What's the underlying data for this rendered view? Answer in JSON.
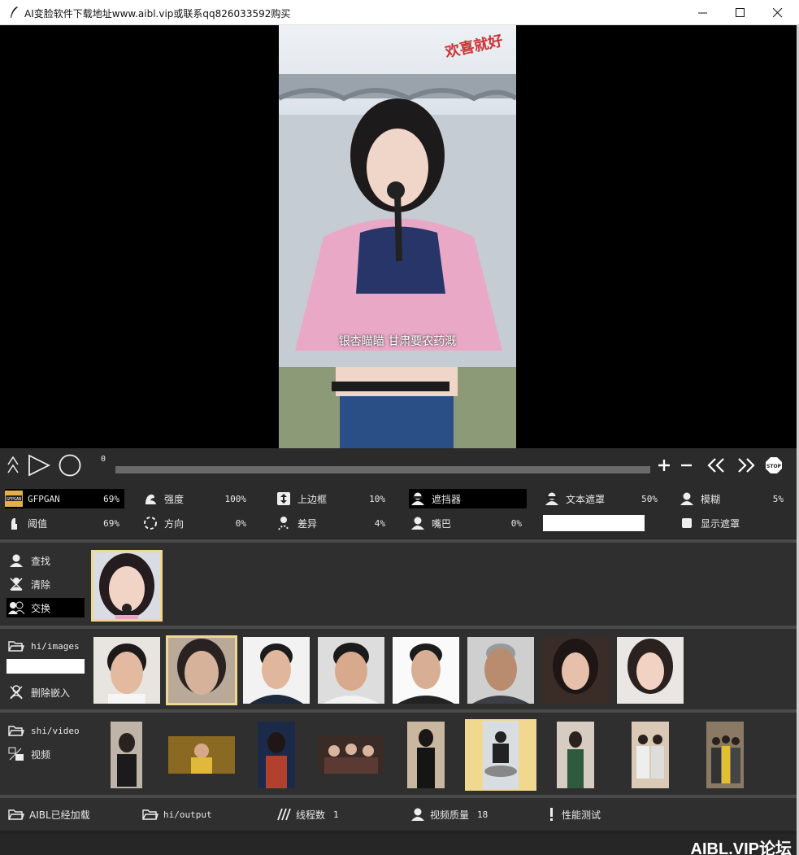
{
  "window": {
    "title": "AI变脸软件下载地址www.aibl.vip或联系qq826033592购买"
  },
  "viewer": {
    "watermark": "欢喜就好",
    "subtitle": "银杏瞄瞄 甘肃要农药溉"
  },
  "playback": {
    "frame_number": "0",
    "progress": 0.0
  },
  "params": {
    "gfpgan": {
      "label": "GFPGAN",
      "value": "69%",
      "icon": "gfpgan-badge-icon"
    },
    "strength": {
      "label": "强度",
      "value": "100%",
      "icon": "arm-icon"
    },
    "top_border": {
      "label": "上边框",
      "value": "10%",
      "icon": "updown-arrow-icon"
    },
    "occluder": {
      "label": "遮挡器",
      "icon": "person-mask-icon"
    },
    "text_mask": {
      "label": "文本遮罩",
      "value": "50%",
      "icon": "person-mask-icon"
    },
    "blur": {
      "label": "模糊",
      "value": "5%",
      "icon": "person-icon"
    },
    "threshold": {
      "label": "阈值",
      "value": "69%",
      "icon": "threshold-icon"
    },
    "orientation": {
      "label": "方向",
      "value": "0%",
      "icon": "rotate-icon"
    },
    "diff": {
      "label": "差异",
      "value": "4%",
      "icon": "diff-icon"
    },
    "mouth": {
      "label": "嘴巴",
      "value": "0%",
      "icon": "person-icon"
    },
    "text_mask_input": "",
    "show_mask": {
      "label": "显示遮罩",
      "checked": false
    }
  },
  "faces_panel": {
    "find": "查找",
    "clear": "清除",
    "swap": "交换"
  },
  "images_panel": {
    "folder": "hi/images",
    "search_value": "",
    "delete_embed": "删除嵌入",
    "thumb_count": 8,
    "selected_index": 1
  },
  "video_panel": {
    "folder": "shi/video",
    "video_label": "视频",
    "thumb_count": 9,
    "selected_index": 5
  },
  "bottom": {
    "aibl_loaded": "AIBL已经加载",
    "output": "hi/output",
    "threads_label": "线程数",
    "threads_value": "1",
    "quality_label": "视频质量",
    "quality_value": "18",
    "perf_test": "性能测试"
  },
  "footer": {
    "brand": "AIBL.VIP论坛"
  },
  "colors": {
    "selection": "#f0d890",
    "panel": "#2f2f2f",
    "separator": "#4a4a4a"
  }
}
